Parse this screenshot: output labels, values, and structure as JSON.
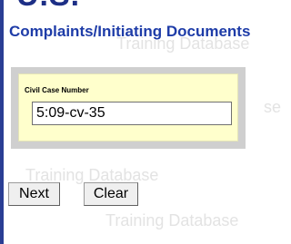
{
  "header": {
    "clipped_heading": "U.S."
  },
  "page": {
    "title": "Complaints/Initiating Documents",
    "watermark": "Training Database",
    "watermark_fragment": "se"
  },
  "form": {
    "case_number_label": "Civil Case Number",
    "case_number_value": "5:09-cv-35"
  },
  "buttons": {
    "next_label": "Next",
    "clear_label": "Clear"
  },
  "colors": {
    "accent": "#1e3ca8",
    "panel": "#cfcfcf",
    "field_highlight": "#ffffcc",
    "watermark": "#e3e3e3"
  }
}
